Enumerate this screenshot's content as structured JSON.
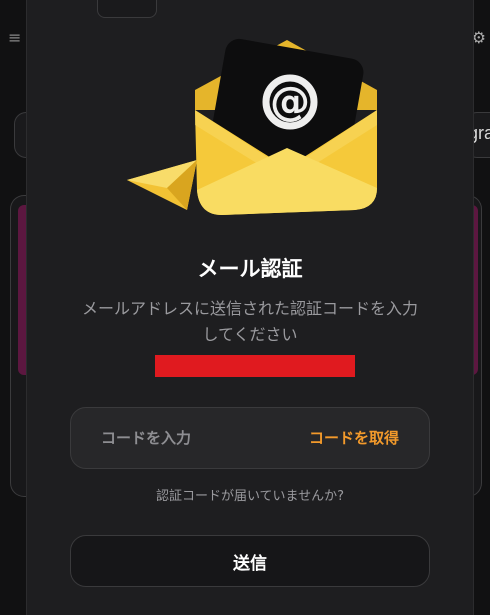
{
  "modal": {
    "title": "メール認証",
    "description": "メールアドレスに送信された認証コードを入力してください",
    "code_input": {
      "placeholder": "コードを入力",
      "value": ""
    },
    "get_code_label": "コードを取得",
    "no_code_link": "認証コードが届いていませんか?",
    "submit_label": "送信"
  },
  "background": {
    "right_tab_text": "gra"
  },
  "colors": {
    "accent": "#f39a2b",
    "redaction": "#e01a1f",
    "modal_bg": "#1e1e20",
    "envelope": "#f5c93a"
  },
  "icons": {
    "hero": "email-envelope-icon",
    "at": "at-sign-icon",
    "paper_plane": "paper-plane-icon"
  }
}
